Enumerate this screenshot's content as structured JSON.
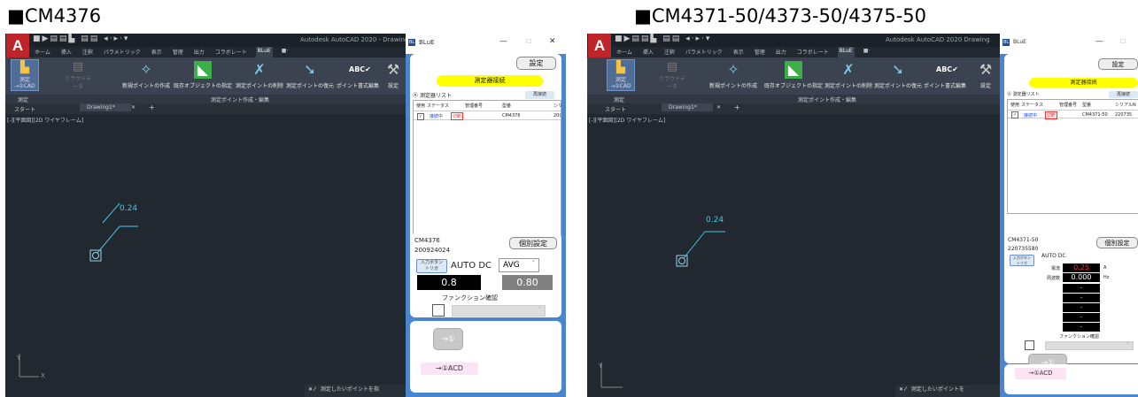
{
  "left": {
    "heading": "■CM4376",
    "cad": {
      "logo": "A",
      "quick_access": "■▶▤▤▙ ▤▤ ◂·▸·▾",
      "app_title": "Autodesk AutoCAD 2020 - Drawing",
      "ribbon_tabs": [
        "ホーム",
        "挿入",
        "注釈",
        "パラメトリック",
        "表示",
        "管理",
        "出力",
        "コラボレート",
        "BLuE",
        "■·"
      ],
      "active_tab": "BLuE",
      "measure_button": "測定\n→①CAD",
      "graph_button": "クラウドデータ",
      "tools": [
        "新規ポイントの作成",
        "既存オブジェクトの指定",
        "測定ポイントの削除",
        "測定ポイントの復元",
        "ポイント書式編集",
        "設定"
      ],
      "panel_left": "測定",
      "panel_center": "測定ポイント作成・編集",
      "start_tab": "スタート",
      "drawing_tab": "Drawing1*",
      "close_x": "✕",
      "add_tab": "+",
      "viewport_label": "[-][平面図][2D ワイヤフレーム]",
      "dimension_text": "0.24",
      "axis_y": "Y",
      "axis_x": "X",
      "status_text": "測定したいポイントを指"
    },
    "window": {
      "title": "BLuE",
      "minimize": "—",
      "maximize": "☐",
      "close": "✕",
      "settings_button": "設定",
      "connect_button": "測定器接続",
      "list_title": "測定器リスト",
      "refresh_button": "再接続",
      "columns": [
        "使用",
        "ステータス",
        "管理番号",
        "型番",
        "シリ"
      ],
      "row": {
        "use": "✓",
        "status": "接続中",
        "cut": "切断",
        "manage_no": "",
        "model": "CM4376",
        "serial": "20("
      },
      "device_model": "CM4376",
      "device_serial": "200924024",
      "individual_button": "個別設定",
      "input_button": "入力ボタン\nトリガ",
      "mode": "AUTO DC",
      "avg_select": "AVG",
      "value_main": "0.8",
      "value_sub": "0.80",
      "function_label": "ファンクション確認",
      "arrow_button": "→①",
      "bottom_button": "→①ACD"
    }
  },
  "right": {
    "heading": "■CM4371-50/4373-50/4375-50",
    "cad": {
      "logo": "A",
      "quick_access": "■▶▤▤▙ ▤▤ ◂·▸·▾",
      "app_title": "Autodesk AutoCAD 2020  Drawing",
      "ribbon_tabs": [
        "ホーム",
        "挿入",
        "注釈",
        "パラメトリック",
        "表示",
        "管理",
        "出力",
        "コラボレート",
        "BLuE",
        "■·"
      ],
      "active_tab": "BLuE",
      "measure_button": "測定\n→①CAD",
      "graph_button": "クラウドデータ",
      "tools": [
        "新規ポイントの作成",
        "既存オブジェクトの指定",
        "測定ポイントの削除",
        "測定ポイントの復元",
        "ポイント書式編集",
        "設定"
      ],
      "panel_left": "測定",
      "panel_center": "測定ポイント作成・編集",
      "start_tab": "スタート",
      "drawing_tab": "Drawing1*",
      "close_x": "✕",
      "add_tab": "+",
      "viewport_label": "[-][平面図][2D ワイヤフレーム]",
      "dimension_text": "0.24",
      "axis_y": "Y",
      "axis_x": "X",
      "status_text": "測定したいポイントを"
    },
    "window": {
      "title": "BLuE",
      "minimize": "—",
      "maximize": "☐",
      "close": "✕",
      "settings_button": "設定",
      "connect_button": "測定器接続",
      "list_title": "測定器リスト",
      "refresh_button": "再接続",
      "columns": [
        "使用",
        "ステータス",
        "管理番号",
        "型番",
        "シリアルN"
      ],
      "row": {
        "use": "✓",
        "status": "接続中",
        "cut": "切断",
        "manage_no": "",
        "model": "CM4371-50",
        "serial": "220735"
      },
      "device_model": "CM4371-50",
      "device_serial": "220735580",
      "individual_button": "個別設定",
      "input_button": "入力ボタン\nトリガ",
      "mode": "AUTO DC",
      "label_current": "電流",
      "value_current": "0.25",
      "unit_current": "A",
      "label_freq": "周波数",
      "value_freq": "0.000",
      "unit_freq": "Hz",
      "dash": "-",
      "function_label": "ファンクション確認",
      "arrow_button": "→①",
      "bottom_button": "→①ACD"
    }
  },
  "colors": {
    "accent_yellow": "#ffff00",
    "window_blue": "#4a86d0",
    "cad_bg": "#212830",
    "dim_cyan": "#46c8e6",
    "pink": "#fbe4f3"
  }
}
